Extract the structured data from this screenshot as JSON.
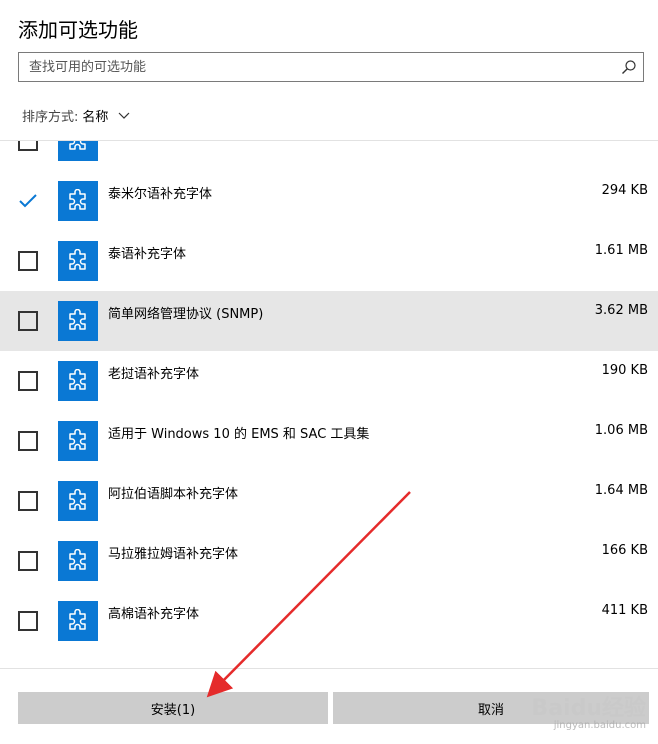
{
  "dialog": {
    "title": "添加可选功能",
    "search_placeholder": "查找可用的可选功能",
    "sort_label": "排序方式:",
    "sort_value": "名称"
  },
  "features": [
    {
      "name": "",
      "size": "",
      "checked": false,
      "highlighted": false,
      "partial": true
    },
    {
      "name": "泰米尔语补充字体",
      "size": "294 KB",
      "checked": true,
      "highlighted": false
    },
    {
      "name": "泰语补充字体",
      "size": "1.61 MB",
      "checked": false,
      "highlighted": false
    },
    {
      "name": "简单网络管理协议 (SNMP)",
      "size": "3.62 MB",
      "checked": false,
      "highlighted": true
    },
    {
      "name": "老挝语补充字体",
      "size": "190 KB",
      "checked": false,
      "highlighted": false
    },
    {
      "name": "适用于 Windows 10 的 EMS 和 SAC 工具集",
      "size": "1.06 MB",
      "checked": false,
      "highlighted": false
    },
    {
      "name": "阿拉伯语脚本补充字体",
      "size": "1.64 MB",
      "checked": false,
      "highlighted": false
    },
    {
      "name": "马拉雅拉姆语补充字体",
      "size": "166 KB",
      "checked": false,
      "highlighted": false
    },
    {
      "name": "高棉语补充字体",
      "size": "411 KB",
      "checked": false,
      "highlighted": false
    }
  ],
  "buttons": {
    "install": "安装(1)",
    "cancel": "取消"
  },
  "watermark": {
    "brand": "Baidu经验",
    "url": "jingyan.baidu.com"
  },
  "icons": {
    "search": "search-icon",
    "sort": "chevron-down-icon",
    "feature": "puzzle-piece-icon",
    "checkbox_checked": "checkmark-icon"
  },
  "colors": {
    "accent": "#0a78d4",
    "highlight_row": "#e6e6e6",
    "button": "#cccccc",
    "annotation_arrow": "#e52b2b"
  }
}
